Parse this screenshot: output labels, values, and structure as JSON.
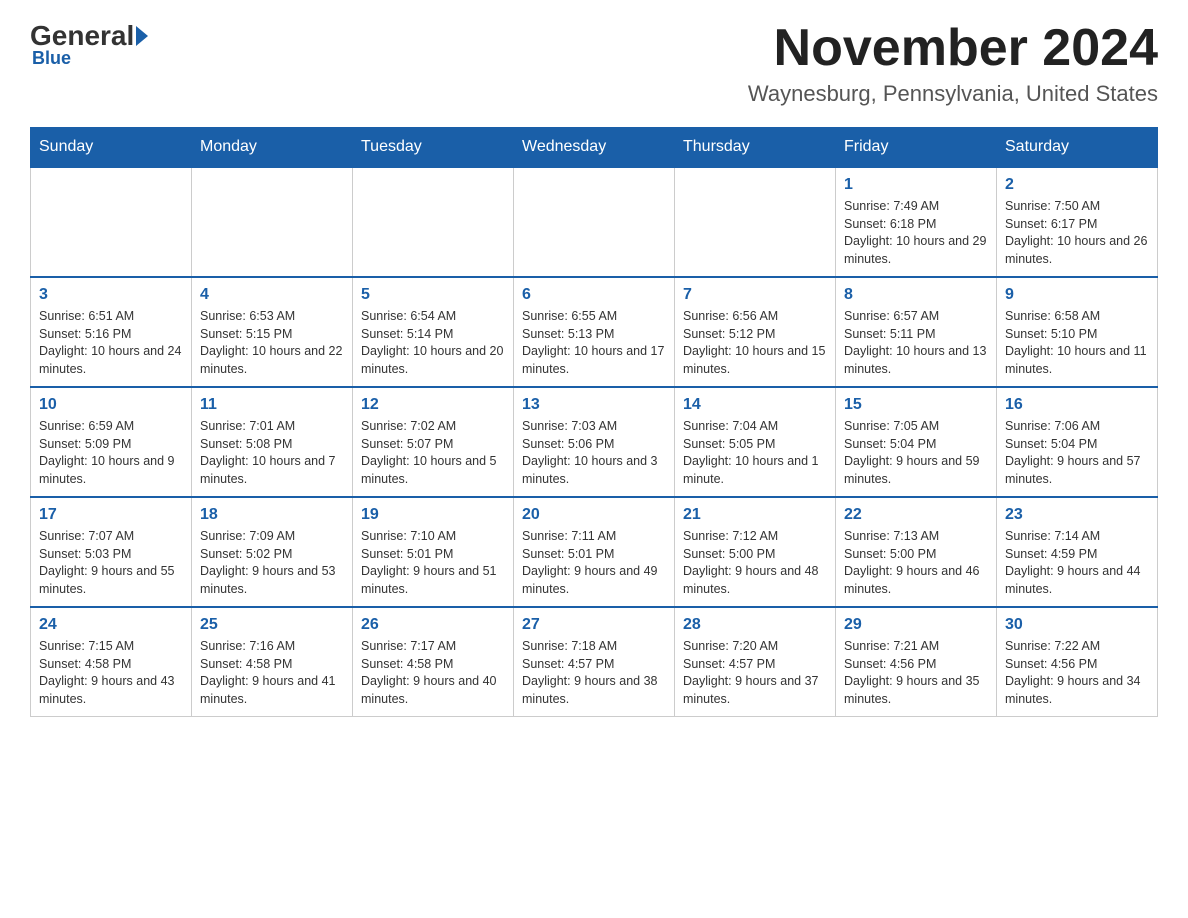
{
  "logo": {
    "general": "General",
    "arrow": "",
    "blue": "Blue"
  },
  "header": {
    "month_year": "November 2024",
    "location": "Waynesburg, Pennsylvania, United States"
  },
  "days_of_week": [
    "Sunday",
    "Monday",
    "Tuesday",
    "Wednesday",
    "Thursday",
    "Friday",
    "Saturday"
  ],
  "weeks": [
    [
      {
        "day": "",
        "info": ""
      },
      {
        "day": "",
        "info": ""
      },
      {
        "day": "",
        "info": ""
      },
      {
        "day": "",
        "info": ""
      },
      {
        "day": "",
        "info": ""
      },
      {
        "day": "1",
        "info": "Sunrise: 7:49 AM\nSunset: 6:18 PM\nDaylight: 10 hours and 29 minutes."
      },
      {
        "day": "2",
        "info": "Sunrise: 7:50 AM\nSunset: 6:17 PM\nDaylight: 10 hours and 26 minutes."
      }
    ],
    [
      {
        "day": "3",
        "info": "Sunrise: 6:51 AM\nSunset: 5:16 PM\nDaylight: 10 hours and 24 minutes."
      },
      {
        "day": "4",
        "info": "Sunrise: 6:53 AM\nSunset: 5:15 PM\nDaylight: 10 hours and 22 minutes."
      },
      {
        "day": "5",
        "info": "Sunrise: 6:54 AM\nSunset: 5:14 PM\nDaylight: 10 hours and 20 minutes."
      },
      {
        "day": "6",
        "info": "Sunrise: 6:55 AM\nSunset: 5:13 PM\nDaylight: 10 hours and 17 minutes."
      },
      {
        "day": "7",
        "info": "Sunrise: 6:56 AM\nSunset: 5:12 PM\nDaylight: 10 hours and 15 minutes."
      },
      {
        "day": "8",
        "info": "Sunrise: 6:57 AM\nSunset: 5:11 PM\nDaylight: 10 hours and 13 minutes."
      },
      {
        "day": "9",
        "info": "Sunrise: 6:58 AM\nSunset: 5:10 PM\nDaylight: 10 hours and 11 minutes."
      }
    ],
    [
      {
        "day": "10",
        "info": "Sunrise: 6:59 AM\nSunset: 5:09 PM\nDaylight: 10 hours and 9 minutes."
      },
      {
        "day": "11",
        "info": "Sunrise: 7:01 AM\nSunset: 5:08 PM\nDaylight: 10 hours and 7 minutes."
      },
      {
        "day": "12",
        "info": "Sunrise: 7:02 AM\nSunset: 5:07 PM\nDaylight: 10 hours and 5 minutes."
      },
      {
        "day": "13",
        "info": "Sunrise: 7:03 AM\nSunset: 5:06 PM\nDaylight: 10 hours and 3 minutes."
      },
      {
        "day": "14",
        "info": "Sunrise: 7:04 AM\nSunset: 5:05 PM\nDaylight: 10 hours and 1 minute."
      },
      {
        "day": "15",
        "info": "Sunrise: 7:05 AM\nSunset: 5:04 PM\nDaylight: 9 hours and 59 minutes."
      },
      {
        "day": "16",
        "info": "Sunrise: 7:06 AM\nSunset: 5:04 PM\nDaylight: 9 hours and 57 minutes."
      }
    ],
    [
      {
        "day": "17",
        "info": "Sunrise: 7:07 AM\nSunset: 5:03 PM\nDaylight: 9 hours and 55 minutes."
      },
      {
        "day": "18",
        "info": "Sunrise: 7:09 AM\nSunset: 5:02 PM\nDaylight: 9 hours and 53 minutes."
      },
      {
        "day": "19",
        "info": "Sunrise: 7:10 AM\nSunset: 5:01 PM\nDaylight: 9 hours and 51 minutes."
      },
      {
        "day": "20",
        "info": "Sunrise: 7:11 AM\nSunset: 5:01 PM\nDaylight: 9 hours and 49 minutes."
      },
      {
        "day": "21",
        "info": "Sunrise: 7:12 AM\nSunset: 5:00 PM\nDaylight: 9 hours and 48 minutes."
      },
      {
        "day": "22",
        "info": "Sunrise: 7:13 AM\nSunset: 5:00 PM\nDaylight: 9 hours and 46 minutes."
      },
      {
        "day": "23",
        "info": "Sunrise: 7:14 AM\nSunset: 4:59 PM\nDaylight: 9 hours and 44 minutes."
      }
    ],
    [
      {
        "day": "24",
        "info": "Sunrise: 7:15 AM\nSunset: 4:58 PM\nDaylight: 9 hours and 43 minutes."
      },
      {
        "day": "25",
        "info": "Sunrise: 7:16 AM\nSunset: 4:58 PM\nDaylight: 9 hours and 41 minutes."
      },
      {
        "day": "26",
        "info": "Sunrise: 7:17 AM\nSunset: 4:58 PM\nDaylight: 9 hours and 40 minutes."
      },
      {
        "day": "27",
        "info": "Sunrise: 7:18 AM\nSunset: 4:57 PM\nDaylight: 9 hours and 38 minutes."
      },
      {
        "day": "28",
        "info": "Sunrise: 7:20 AM\nSunset: 4:57 PM\nDaylight: 9 hours and 37 minutes."
      },
      {
        "day": "29",
        "info": "Sunrise: 7:21 AM\nSunset: 4:56 PM\nDaylight: 9 hours and 35 minutes."
      },
      {
        "day": "30",
        "info": "Sunrise: 7:22 AM\nSunset: 4:56 PM\nDaylight: 9 hours and 34 minutes."
      }
    ]
  ]
}
